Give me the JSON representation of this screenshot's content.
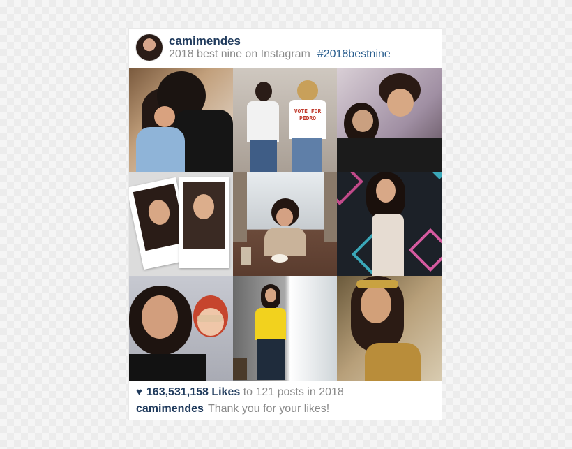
{
  "post": {
    "username": "camimendes",
    "caption": "2018 best nine on Instagram",
    "hashtag": "#2018bestnine"
  },
  "grid": {
    "tiles": [
      {
        "id": 1,
        "description": "couple-hug-bedroom"
      },
      {
        "id": 2,
        "description": "two-friends-vote-for-pedro"
      },
      {
        "id": 3,
        "description": "couple-selfie"
      },
      {
        "id": 4,
        "description": "polaroid-portraits"
      },
      {
        "id": 5,
        "description": "cafe-window-phone"
      },
      {
        "id": 6,
        "description": "event-backdrop-dress"
      },
      {
        "id": 7,
        "description": "friends-selfie-sunglasses"
      },
      {
        "id": 8,
        "description": "yellow-tshirt-standing"
      },
      {
        "id": 9,
        "description": "golden-costume-portrait"
      }
    ],
    "tile_shirt_text": "VOTE FOR PEDRO"
  },
  "footer": {
    "likes_count": "163,531,158 Likes",
    "likes_context": "to 121 posts in 2018",
    "comment_user": "camimendes",
    "comment_text": "Thank you for your likes!"
  },
  "colors": {
    "brand_text": "#1f3a5c",
    "hashtag": "#2b5f8f",
    "muted": "#8a8a8a"
  },
  "icons": {
    "heart": "heart-icon"
  }
}
